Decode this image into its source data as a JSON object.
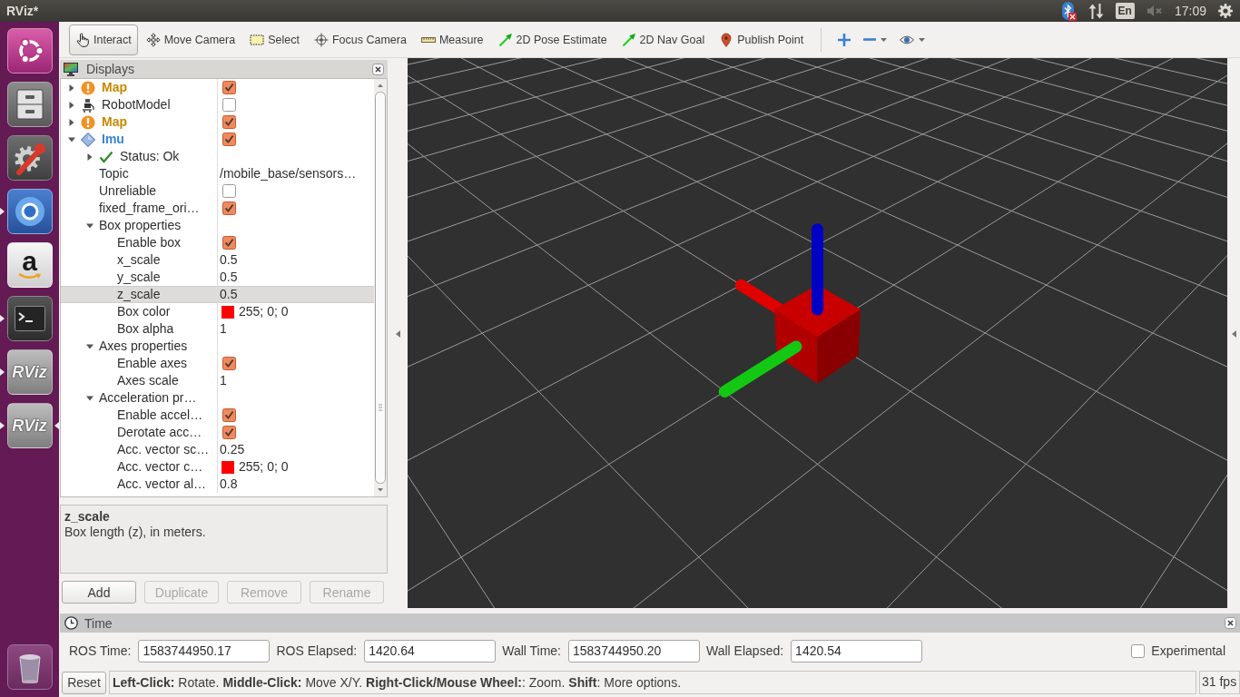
{
  "top_bar": {
    "title": "RViz*",
    "bluetooth": {
      "on": false
    },
    "keyboard": "En",
    "volume": {
      "muted": true
    },
    "clock": "17:09"
  },
  "launcher": {
    "items": [
      {
        "kind": "dash",
        "running": false,
        "active": false
      },
      {
        "kind": "files",
        "running": false,
        "active": false
      },
      {
        "kind": "settings",
        "running": false,
        "active": false
      },
      {
        "kind": "browser",
        "running": true,
        "active": false
      },
      {
        "kind": "store",
        "label": "a",
        "running": false,
        "active": false
      },
      {
        "kind": "terminal",
        "running": true,
        "active": false
      },
      {
        "kind": "app",
        "label": "RViz",
        "running": true,
        "active": false
      },
      {
        "kind": "app",
        "label": "RViz",
        "running": true,
        "active": true
      }
    ]
  },
  "toolbar": {
    "tools": [
      {
        "label": "Interact",
        "selected": true
      },
      {
        "label": "Move Camera",
        "selected": false
      },
      {
        "label": "Select",
        "selected": false
      },
      {
        "label": "Focus Camera",
        "selected": false
      },
      {
        "label": "Measure",
        "selected": false
      },
      {
        "label": "2D Pose Estimate",
        "selected": false
      },
      {
        "label": "2D Nav Goal",
        "selected": false
      },
      {
        "label": "Publish Point",
        "selected": false
      }
    ]
  },
  "displays": {
    "title": "Displays",
    "items": [
      {
        "kind": "map",
        "label": "Map",
        "color": "#c78a00",
        "warning": true,
        "checked": true,
        "expanded": false,
        "selected": false
      },
      {
        "kind": "robot_model",
        "label": "RobotModel",
        "color": "#2e2e2e",
        "warning": false,
        "checked": false,
        "expanded": false,
        "selected": false
      },
      {
        "kind": "map",
        "label": "Map",
        "color": "#c78a00",
        "warning": true,
        "checked": true,
        "expanded": false,
        "selected": false
      },
      {
        "kind": "imu",
        "label": "Imu",
        "color": "#3b83d6",
        "warning": false,
        "checked": true,
        "expanded": true,
        "selected": false,
        "children": [
          {
            "kind": "status",
            "label": "Status: Ok",
            "warning": false,
            "expanded": false,
            "selected": false
          },
          {
            "kind": "text",
            "label": "Topic",
            "value": "/mobile_base/sensors…",
            "selected": false
          },
          {
            "kind": "checkbox",
            "label": "Unreliable",
            "checked": false,
            "selected": false
          },
          {
            "kind": "checkbox",
            "label": "fixed_frame_ori…",
            "checked": true,
            "selected": false
          },
          {
            "kind": "group",
            "label": "Box properties",
            "expanded": true,
            "selected": false,
            "children": [
              {
                "kind": "checkbox",
                "label": "Enable box",
                "checked": true,
                "selected": false
              },
              {
                "kind": "text",
                "label": "x_scale",
                "value": "0.5",
                "selected": false
              },
              {
                "kind": "text",
                "label": "y_scale",
                "value": "0.5",
                "selected": false
              },
              {
                "kind": "text",
                "label": "z_scale",
                "value": "0.5",
                "selected": true
              },
              {
                "kind": "color",
                "label": "Box color",
                "color": "#ff0000",
                "value": "255; 0; 0",
                "selected": false
              },
              {
                "kind": "text",
                "label": "Box alpha",
                "value": "1",
                "selected": false
              }
            ]
          },
          {
            "kind": "group",
            "label": "Axes properties",
            "expanded": true,
            "selected": false,
            "children": [
              {
                "kind": "checkbox",
                "label": "Enable axes",
                "checked": true,
                "selected": false
              },
              {
                "kind": "text",
                "label": "Axes scale",
                "value": "1",
                "selected": false
              }
            ]
          },
          {
            "kind": "group",
            "label": "Acceleration pr…",
            "expanded": true,
            "selected": false,
            "children": [
              {
                "kind": "checkbox",
                "label": "Enable accel…",
                "checked": true,
                "selected": false
              },
              {
                "kind": "checkbox",
                "label": "Derotate acc…",
                "checked": true,
                "selected": false
              },
              {
                "kind": "text",
                "label": "Acc. vector sc…",
                "value": "0.25",
                "selected": false
              },
              {
                "kind": "color",
                "label": "Acc. vector c…",
                "color": "#ff0000",
                "value": "255; 0; 0",
                "selected": false
              },
              {
                "kind": "text",
                "label": "Acc. vector al…",
                "value": "0.8",
                "selected": false
              }
            ]
          }
        ]
      }
    ],
    "description": {
      "title": "z_scale",
      "text": "Box length (z), in meters."
    },
    "buttons": [
      {
        "label": "Add",
        "disabled": false
      },
      {
        "label": "Duplicate",
        "disabled": true
      },
      {
        "label": "Remove",
        "disabled": true
      },
      {
        "label": "Rename",
        "disabled": true
      }
    ]
  },
  "time_panel": {
    "title": "Time",
    "fields": [
      {
        "label": "ROS Time:",
        "value": "1583744950.17"
      },
      {
        "label": "ROS Elapsed:",
        "value": "1420.64"
      },
      {
        "label": "Wall Time:",
        "value": "1583744950.20"
      },
      {
        "label": "Wall Elapsed:",
        "value": "1420.54"
      }
    ],
    "experimental": {
      "label": "Experimental",
      "checked": false
    }
  },
  "status_bar": {
    "reset": "Reset",
    "message": "**Left-Click:** Rotate. **Middle-Click:** Move X/Y. **Right-Click/Mouse Wheel:**: Zoom. **Shift**: More options.",
    "fps": "31 fps"
  }
}
